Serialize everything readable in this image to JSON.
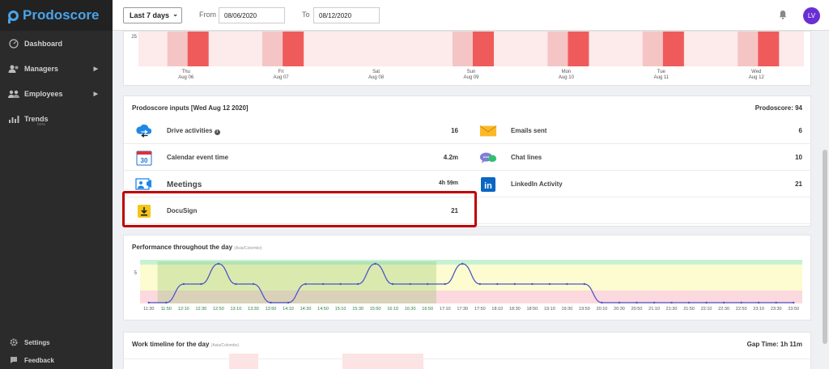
{
  "brand": {
    "name": "Prodoscore",
    "color": "#4aa3e8"
  },
  "sidebar": {
    "items": [
      {
        "label": "Dashboard",
        "icon": "gauge-icon"
      },
      {
        "label": "Managers",
        "icon": "managers-icon"
      },
      {
        "label": "Employees",
        "icon": "employees-icon"
      },
      {
        "label": "Trends",
        "icon": "trends-icon",
        "sub": "beta"
      }
    ],
    "bottom": [
      {
        "label": "Settings",
        "icon": "gear-icon"
      },
      {
        "label": "Feedback",
        "icon": "feedback-icon"
      }
    ]
  },
  "topbar": {
    "range_select": "Last 7 days",
    "from_label": "From",
    "from_value": "08/06/2020",
    "to_label": "To",
    "to_value": "08/12/2020",
    "avatar_initials": "LV",
    "avatar_color": "#6a2fd4"
  },
  "top_chart": {
    "y_tick": "25",
    "days": [
      {
        "dow": "Thu",
        "date": "Aug 06"
      },
      {
        "dow": "Fri",
        "date": "Aug 07"
      },
      {
        "dow": "Sat",
        "date": "Aug 08"
      },
      {
        "dow": "Sun",
        "date": "Aug 09"
      },
      {
        "dow": "Mon",
        "date": "Aug 10"
      },
      {
        "dow": "Tue",
        "date": "Aug 11"
      },
      {
        "dow": "Wed",
        "date": "Aug 12"
      }
    ]
  },
  "inputs": {
    "title": "Prodoscore inputs [Wed Aug 12 2020]",
    "score_label": "Prodoscore: 94",
    "left": [
      {
        "name": "Drive activities",
        "value": "16",
        "icon": "cloud-drive-icon",
        "info": true
      },
      {
        "name": "Calendar event time",
        "value": "4.2m",
        "icon": "calendar-icon",
        "badge": "30"
      },
      {
        "name": "Meetings",
        "value": "4h 59m",
        "icon": "video-meeting-icon"
      },
      {
        "name": "DocuSign",
        "value": "21",
        "icon": "docusign-icon"
      }
    ],
    "right": [
      {
        "name": "Emails sent",
        "value": "6",
        "icon": "email-icon"
      },
      {
        "name": "Chat lines",
        "value": "10",
        "icon": "chat-icon"
      },
      {
        "name": "LinkedIn Activity",
        "value": "21",
        "icon": "linkedin-icon",
        "badge": "in"
      }
    ]
  },
  "performance": {
    "title": "Performance throughout the day",
    "tz": "(Asia/Colombo)",
    "y_tick": "5",
    "times": [
      "11:30",
      "11:50",
      "12:10",
      "12:30",
      "12:50",
      "13:10",
      "13:30",
      "13:50",
      "14:10",
      "14:30",
      "14:50",
      "15:10",
      "15:30",
      "15:50",
      "16:10",
      "16:30",
      "16:50",
      "17:10",
      "17:30",
      "17:50",
      "18:10",
      "18:30",
      "18:50",
      "19:10",
      "19:30",
      "19:50",
      "20:10",
      "20:30",
      "20:50",
      "21:10",
      "21:30",
      "21:50",
      "22:10",
      "22:30",
      "22:50",
      "23:10",
      "23:30",
      "23:50"
    ],
    "highlighted_range": [
      "11:50",
      "16:50"
    ]
  },
  "work": {
    "title": "Work timeline for the day",
    "tz": "(Asia/Colombo)",
    "gap_time": "Gap Time: 1h 11m"
  }
}
